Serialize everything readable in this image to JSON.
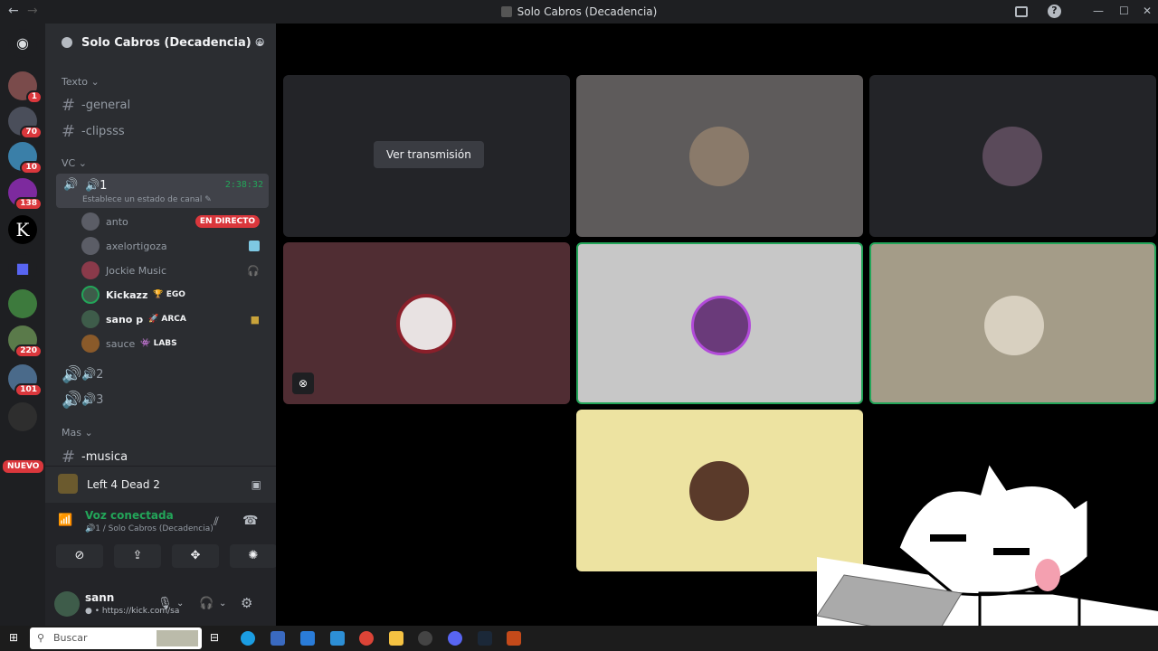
{
  "titlebar": {
    "title": "Solo Cabros (Decadencia)",
    "back": "←",
    "fwd": "→",
    "help": "?",
    "min": "—",
    "max": "☐",
    "close": "✕"
  },
  "guilds": [
    {
      "badge": "1"
    },
    {
      "badge": "70"
    },
    {
      "badge": "10"
    },
    {
      "badge": "138"
    },
    {
      "badge": ""
    },
    {
      "badge": ""
    },
    {
      "badge": ""
    },
    {
      "badge": "220"
    },
    {
      "badge": "101"
    },
    {
      "badge": ""
    }
  ],
  "guild_k": "K",
  "nuevo": "NUEVO",
  "server": {
    "name": "Solo Cabros (Decadencia) ⌄"
  },
  "categories": {
    "texto": "Texto ⌄",
    "vc": "VC ⌄",
    "mas": "Mas ⌄"
  },
  "text_channels": [
    {
      "name": "-general"
    },
    {
      "name": "-clipsss"
    }
  ],
  "voice_channel": {
    "name": "🔊1",
    "time": "2:38:32",
    "status": "Establece un estado de canal ✎"
  },
  "voice_users": [
    {
      "name": "anto",
      "tag": "",
      "live": "EN DIRECTO"
    },
    {
      "name": "axelortigoza",
      "tag": "",
      "live": ""
    },
    {
      "name": "Jockie Music",
      "tag": "",
      "live": ""
    },
    {
      "name": "Kickazz",
      "tag": "🏆 EGO",
      "live": ""
    },
    {
      "name": "sano p",
      "tag": "🚀 ARCA",
      "live": ""
    },
    {
      "name": "sauce",
      "tag": "👾 LABS",
      "live": ""
    }
  ],
  "other_voice": [
    {
      "name": "🔊2"
    },
    {
      "name": "🔊3"
    }
  ],
  "musica": "-musica",
  "game": {
    "name": "Left 4 Dead 2"
  },
  "voice": {
    "title": "Voz conectada",
    "sub": "🔊1 / Solo Cabros (Decadencia)"
  },
  "user": {
    "name": "sann",
    "status": "● • https://kick.com/sa"
  },
  "stage": {
    "ver": "Ver transmisión"
  },
  "taskbar": {
    "search": "Buscar"
  },
  "colors": {
    "bg": "#1e1f22",
    "accent": "#23a559",
    "live": "#da373c"
  }
}
